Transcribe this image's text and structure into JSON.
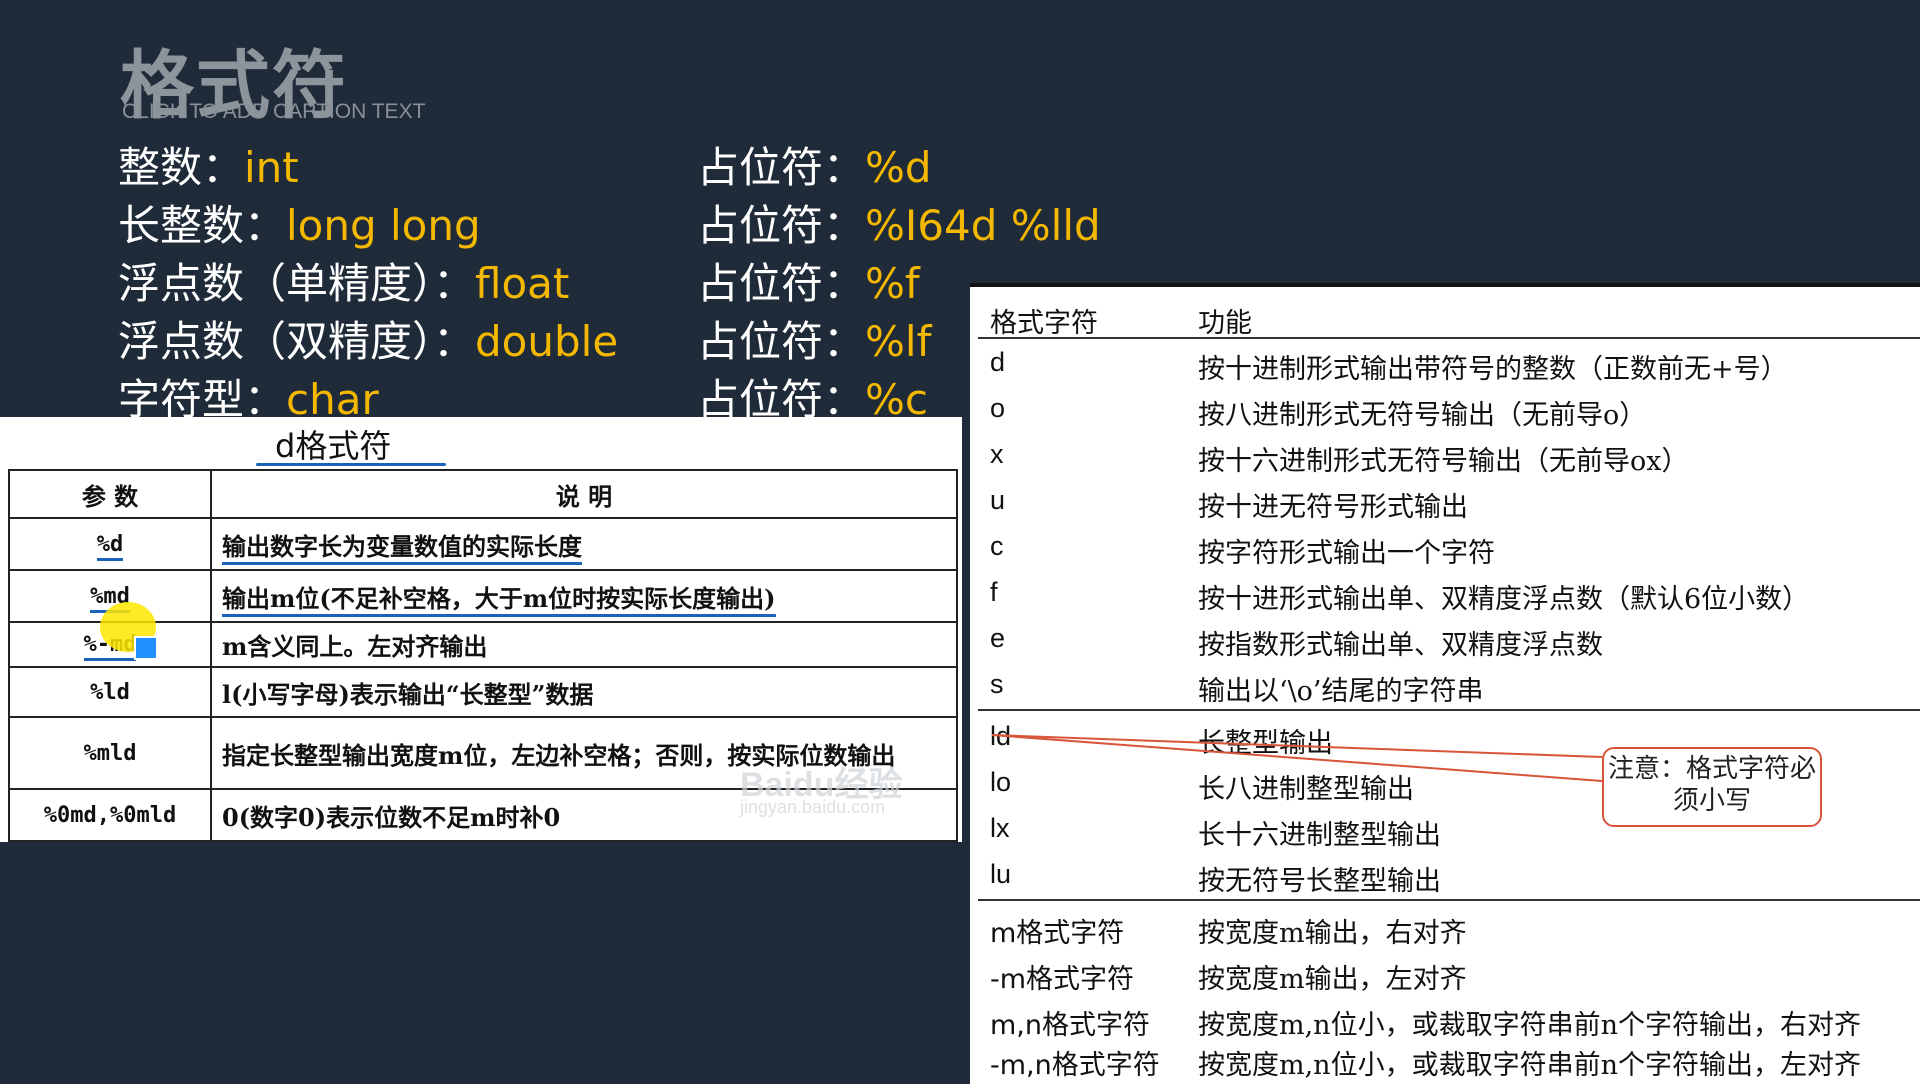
{
  "slide": {
    "title": "格式符",
    "caption": "CLICK TO ADD CAPTION TEXT"
  },
  "types": [
    {
      "label": "整数：",
      "value": "int",
      "ph_label": "占位符：",
      "ph_value": "%d"
    },
    {
      "label": "长整数：",
      "value": "long long",
      "ph_label": "占位符：",
      "ph_value": "%I64d %lld"
    },
    {
      "label": "浮点数（单精度）：",
      "value": "float",
      "ph_label": "占位符：",
      "ph_value": "%f"
    },
    {
      "label": "浮点数（双精度）：",
      "value": "double",
      "ph_label": "占位符：",
      "ph_value": "%lf"
    },
    {
      "label": "字符型：",
      "value": "char",
      "ph_label": "占位符：",
      "ph_value": "%c"
    }
  ],
  "d_table": {
    "title": "d格式符",
    "headers": [
      "参 数",
      "说 明"
    ],
    "rows": [
      {
        "param": "%d",
        "desc": "输出数字长为变量数值的实际长度"
      },
      {
        "param": "%md",
        "desc": "输出m位(不足补空格，大于m位时按实际长度输出)"
      },
      {
        "param": "%-md",
        "desc": "m含义同上。左对齐输出"
      },
      {
        "param": "%ld",
        "desc": "l(小写字母)表示输出“长整型”数据"
      },
      {
        "param": "%mld",
        "desc": "指定长整型输出宽度m位，左边补空格；否则，按实际位数输出"
      },
      {
        "param": "%0md,%0mld",
        "desc": "0(数字0)表示位数不足m时补0"
      }
    ],
    "watermark": "Baidu经验",
    "watermark_sub": "jingyan.baidu.com"
  },
  "format_table": {
    "headers": [
      "格式字符",
      "功能"
    ],
    "group1": [
      {
        "char": "d",
        "func": "按十进制形式输出带符号的整数（正数前无+号）"
      },
      {
        "char": "o",
        "func": "按八进制形式无符号输出（无前导o）"
      },
      {
        "char": "x",
        "func": "按十六进制形式无符号输出（无前导ox）"
      },
      {
        "char": "u",
        "func": "按十进无符号形式输出"
      },
      {
        "char": "c",
        "func": "按字符形式输出一个字符"
      },
      {
        "char": "f",
        "func": "按十进形式输出单、双精度浮点数（默认6位小数）"
      },
      {
        "char": "e",
        "func": "按指数形式输出单、双精度浮点数"
      },
      {
        "char": "s",
        "func": "输出以‘\\o’结尾的字符串"
      }
    ],
    "group2": [
      {
        "char": "ld",
        "func": "长整型输出"
      },
      {
        "char": "lo",
        "func": "长八进制整型输出"
      },
      {
        "char": "lx",
        "func": "长十六进制整型输出"
      },
      {
        "char": "lu",
        "func": "按无符号长整型输出"
      }
    ],
    "group3": [
      {
        "char": "m格式字符",
        "func": "按宽度m输出，右对齐"
      },
      {
        "char": "-m格式字符",
        "func": "按宽度m输出，左对齐"
      },
      {
        "char": "m,n格式字符",
        "func": "按宽度m,n位小，或裁取字符串前n个字符输出，右对齐"
      },
      {
        "char": "-m,n格式字符",
        "func": "按宽度m,n位小，或裁取字符串前n个字符输出，左对齐"
      }
    ],
    "note": "注意：格式字符必须小写"
  }
}
